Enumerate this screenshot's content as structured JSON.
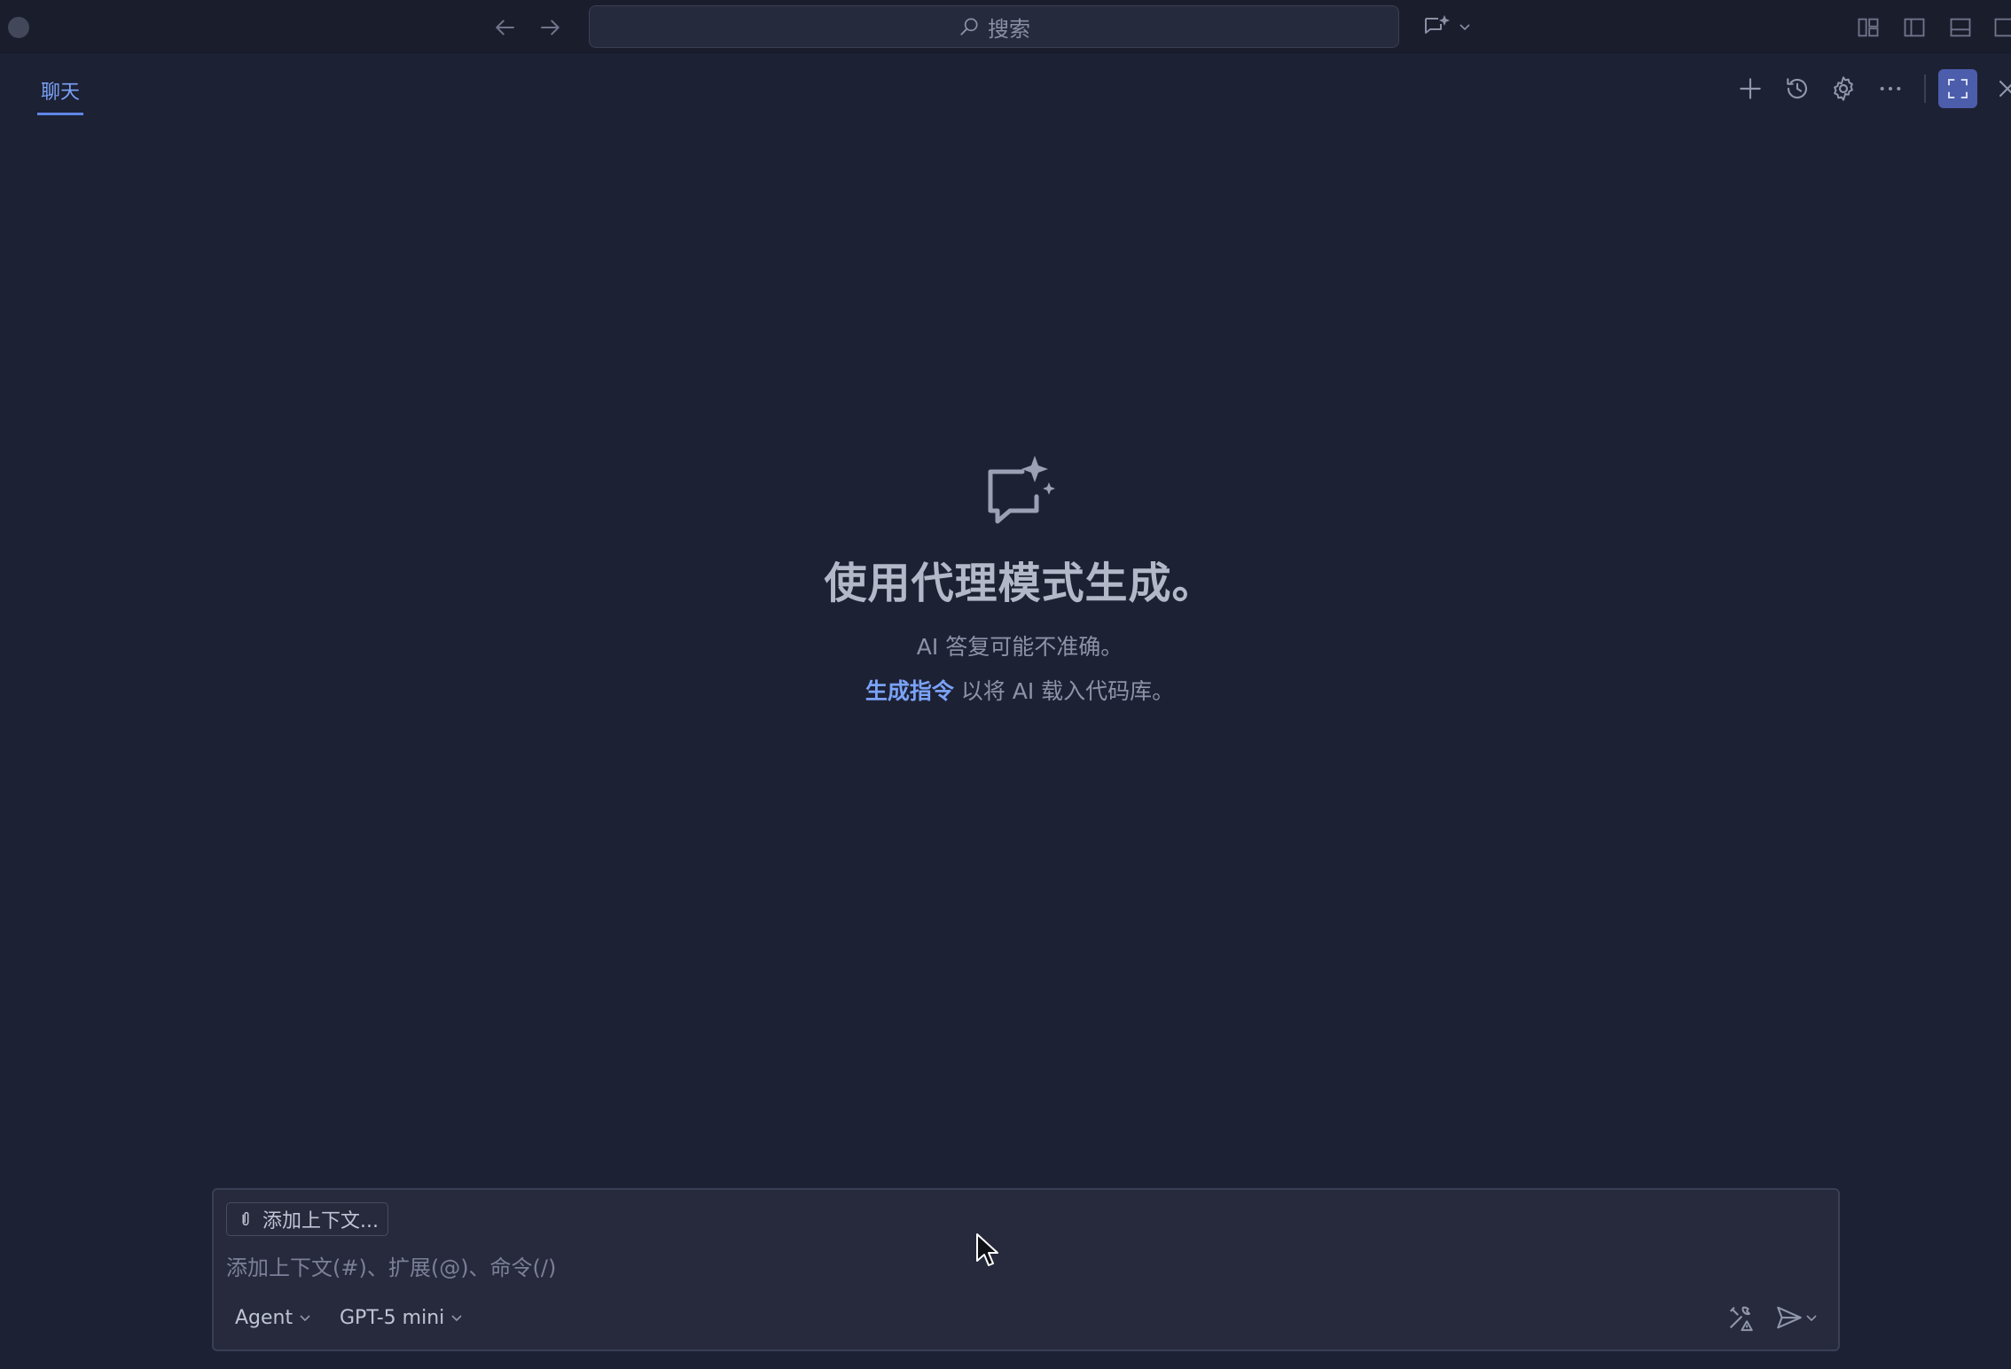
{
  "titlebar": {
    "search_label": "搜索",
    "icons": [
      "arrow-left-icon",
      "arrow-right-icon",
      "search-icon",
      "copilot-sparkle-icon",
      "chevron-down-icon",
      "layout-customize-icon",
      "toggle-sidebar-icon",
      "toggle-panel-icon",
      "toggle-secondary-sidebar-icon"
    ]
  },
  "panel": {
    "tab_label": "聊天",
    "icons": [
      "plus-icon",
      "history-icon",
      "gear-icon",
      "more-icon",
      "maximize-icon",
      "close-icon"
    ]
  },
  "welcome": {
    "title": "使用代理模式生成。",
    "subtitle": "AI 答复可能不准确。",
    "link_text": "生成指令",
    "line_rest": " 以将 AI 载入代码库。"
  },
  "composer": {
    "add_context_label": "添加上下文...",
    "placeholder": "添加上下文(#)、扩展(@)、命令(/)",
    "mode_label": "Agent",
    "model_label": "GPT-5 mini"
  },
  "colors": {
    "background": "#1d2134",
    "accent": "#7aa2f7",
    "maximize_active": "#4b5dab"
  }
}
